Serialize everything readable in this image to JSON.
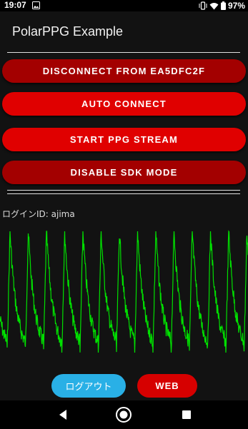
{
  "status_bar": {
    "time": "19:07",
    "battery": "97%",
    "icons": [
      "image-icon",
      "vibrate-icon",
      "wifi-icon",
      "battery-icon"
    ]
  },
  "app": {
    "title": "PolarPPG Example",
    "buttons": [
      {
        "label": "DISCONNECT FROM EA5DFC2F",
        "color": "#a30000"
      },
      {
        "label": "AUTO CONNECT",
        "color": "#e00000"
      },
      {
        "label": "START PPG STREAM",
        "color": "#e00000"
      },
      {
        "label": "DISABLE SDK MODE",
        "color": "#a30000"
      }
    ],
    "login_label": "ログインID: ajima",
    "ppg_color": "#00e000",
    "logout_label": "ログアウト",
    "web_label": "WEB",
    "accent_colors": {
      "logout": "#29b0e6",
      "web": "#d60000"
    }
  },
  "nav": {
    "icons": [
      "back-icon",
      "home-icon",
      "recents-icon"
    ]
  }
}
